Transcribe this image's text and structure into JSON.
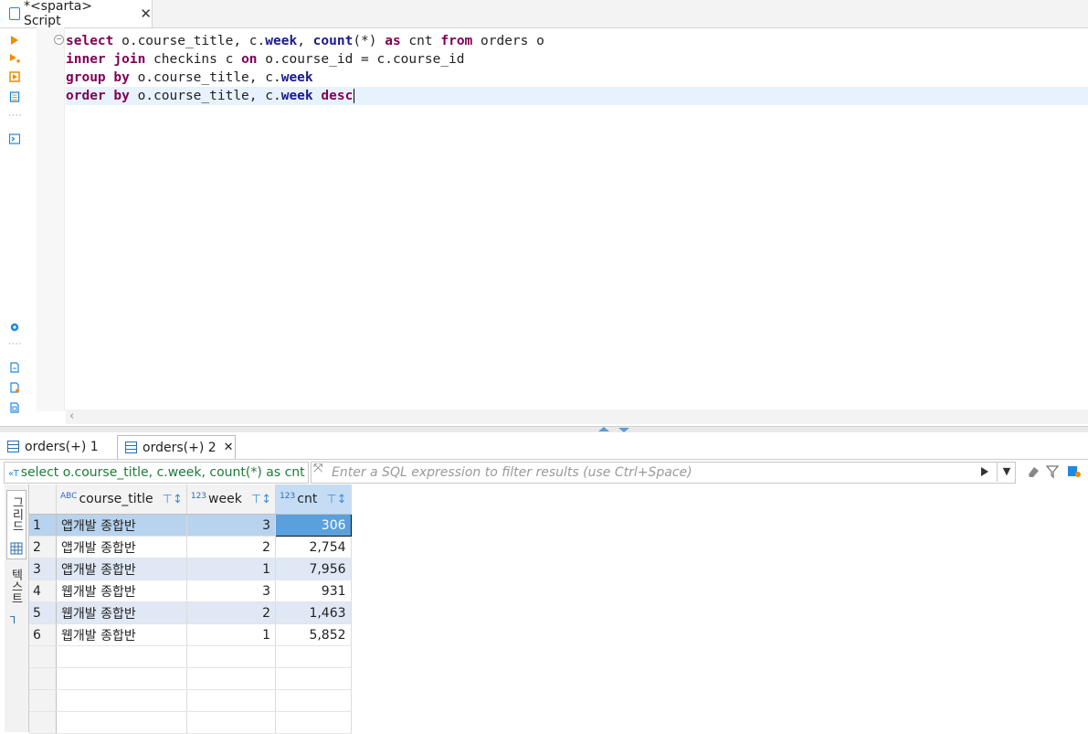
{
  "editor_tab": {
    "title": "*<sparta> Script",
    "close": "✕"
  },
  "code": [
    [
      {
        "t": "select",
        "c": "kw"
      },
      {
        "t": " o.course_title, c."
      },
      {
        "t": "week",
        "c": "fn"
      },
      {
        "t": ", "
      },
      {
        "t": "count",
        "c": "fn"
      },
      {
        "t": "(*) "
      },
      {
        "t": "as",
        "c": "kw"
      },
      {
        "t": " cnt "
      },
      {
        "t": "from",
        "c": "kw"
      },
      {
        "t": " orders o"
      }
    ],
    [
      {
        "t": "inner join",
        "c": "kw"
      },
      {
        "t": " checkins c "
      },
      {
        "t": "on",
        "c": "kw"
      },
      {
        "t": " o.course_id = c.course_id"
      }
    ],
    [
      {
        "t": "group by",
        "c": "kw"
      },
      {
        "t": " o.course_title, c."
      },
      {
        "t": "week",
        "c": "fn"
      }
    ],
    [
      {
        "t": "order by",
        "c": "kw"
      },
      {
        "t": " o.course_title, c."
      },
      {
        "t": "week",
        "c": "fn"
      },
      {
        "t": " "
      },
      {
        "t": "desc",
        "c": "kw"
      }
    ]
  ],
  "result_tabs": [
    {
      "label": "orders(+) 1",
      "active": false
    },
    {
      "label": "orders(+) 2",
      "active": true,
      "close": "✕"
    }
  ],
  "filter": {
    "query_preview": "select o.course_title, c.week, count(*) as cnt fr",
    "placeholder": "Enter a SQL expression to filter results (use Ctrl+Space)"
  },
  "side_tabs": {
    "grid": "그리드",
    "text": "텍스트"
  },
  "columns": [
    {
      "name": "course_title",
      "type": "ABC"
    },
    {
      "name": "week",
      "type": "123"
    },
    {
      "name": "cnt",
      "type": "123"
    }
  ],
  "rows": [
    [
      "1",
      "앱개발 종합반",
      "3",
      "306"
    ],
    [
      "2",
      "앱개발 종합반",
      "2",
      "2,754"
    ],
    [
      "3",
      "앱개발 종합반",
      "1",
      "7,956"
    ],
    [
      "4",
      "웹개발 종합반",
      "3",
      "931"
    ],
    [
      "5",
      "웹개발 종합반",
      "2",
      "1,463"
    ],
    [
      "6",
      "웹개발 종합반",
      "1",
      "5,852"
    ]
  ]
}
